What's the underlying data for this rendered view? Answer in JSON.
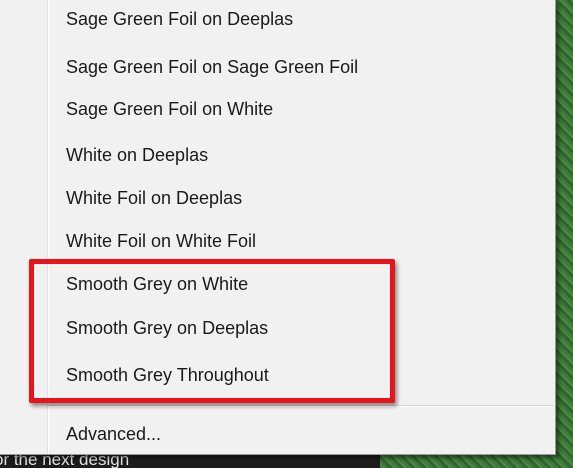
{
  "background": {
    "partial_text": "or the next design"
  },
  "menu": {
    "items": [
      {
        "label": "Sage Green Foil on Deeplas"
      },
      {
        "label": "Sage Green Foil on Sage Green Foil"
      },
      {
        "label": "Sage Green Foil on White"
      },
      {
        "label": "White on Deeplas"
      },
      {
        "label": "White Foil on Deeplas"
      },
      {
        "label": "White Foil on White Foil"
      },
      {
        "label": "Smooth Grey on White"
      },
      {
        "label": "Smooth Grey on Deeplas"
      },
      {
        "label": "Smooth Grey Throughout"
      }
    ],
    "footer_item": {
      "label": "Advanced..."
    }
  },
  "annotation": {
    "highlight_color": "#e8141a"
  }
}
